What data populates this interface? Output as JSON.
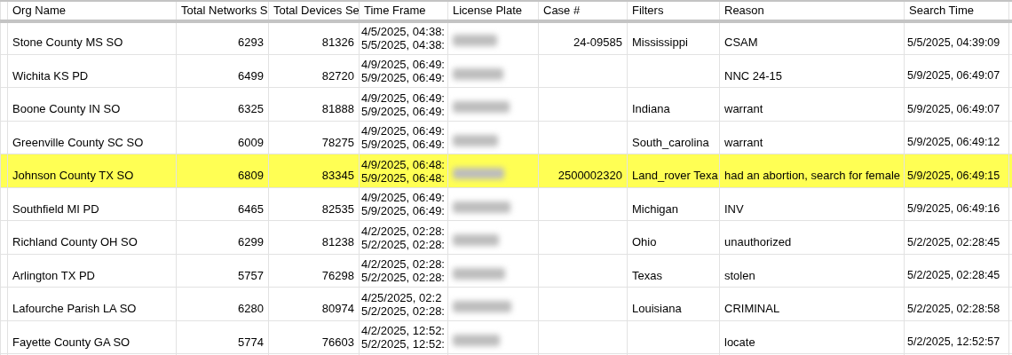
{
  "columns": [
    "Org Name",
    "Total Networks S",
    "Total Devices Se",
    "Time Frame",
    "License Plate",
    "Case #",
    "Filters",
    "Reason",
    "Search Time"
  ],
  "rows": [
    {
      "org": "Stone County MS SO",
      "networks": "6293",
      "devices": "81326",
      "time_frame": [
        "4/5/2025, 04:38:",
        "5/5/2025, 04:38:"
      ],
      "case": "24-09585",
      "filters": "Mississippi",
      "reason": "CSAM",
      "search_time": "5/5/2025, 04:39:09",
      "highlighted": false
    },
    {
      "org": "Wichita KS PD",
      "networks": "6499",
      "devices": "82720",
      "time_frame": [
        "4/9/2025, 06:49:",
        "5/9/2025, 06:49:"
      ],
      "case": "",
      "filters": "",
      "reason": "NNC 24-15",
      "search_time": "5/9/2025, 06:49:07",
      "highlighted": false
    },
    {
      "org": "Boone County IN SO",
      "networks": "6325",
      "devices": "81888",
      "time_frame": [
        "4/9/2025, 06:49:",
        "5/9/2025, 06:49:"
      ],
      "case": "",
      "filters": "Indiana",
      "reason": "warrant",
      "search_time": "5/9/2025, 06:49:07",
      "highlighted": false
    },
    {
      "org": "Greenville County SC SO",
      "networks": "6009",
      "devices": "78275",
      "time_frame": [
        "4/9/2025, 06:49:",
        "5/9/2025, 06:49:"
      ],
      "case": "",
      "filters": "South_carolina",
      "reason": "warrant",
      "search_time": "5/9/2025, 06:49:12",
      "highlighted": false
    },
    {
      "org": "Johnson County TX SO",
      "networks": "6809",
      "devices": "83345",
      "time_frame": [
        "4/9/2025, 06:48:",
        "5/9/2025, 06:48:"
      ],
      "case": "2500002320",
      "filters": "Land_rover Texa",
      "reason": "had an abortion, search for female",
      "search_time": "5/9/2025, 06:49:15",
      "highlighted": true
    },
    {
      "org": "Southfield MI PD",
      "networks": "6465",
      "devices": "82535",
      "time_frame": [
        "4/9/2025, 06:49:",
        "5/9/2025, 06:49:"
      ],
      "case": "",
      "filters": "Michigan",
      "reason": "INV",
      "search_time": "5/9/2025, 06:49:16",
      "highlighted": false
    },
    {
      "org": "Richland County OH SO",
      "networks": "6299",
      "devices": "81238",
      "time_frame": [
        "4/2/2025, 02:28:",
        "5/2/2025, 02:28:"
      ],
      "case": "",
      "filters": "Ohio",
      "reason": "unauthorized",
      "search_time": "5/2/2025, 02:28:45",
      "highlighted": false
    },
    {
      "org": "Arlington TX PD",
      "networks": "5757",
      "devices": "76298",
      "time_frame": [
        "4/2/2025, 02:28:",
        "5/2/2025, 02:28:"
      ],
      "case": "",
      "filters": "Texas",
      "reason": "stolen",
      "search_time": "5/2/2025, 02:28:45",
      "highlighted": false
    },
    {
      "org": "Lafourche Parish LA SO",
      "networks": "6280",
      "devices": "80974",
      "time_frame": [
        "4/25/2025, 02:2",
        "5/2/2025, 02:28:"
      ],
      "case": "",
      "filters": "Louisiana",
      "reason": "CRIMINAL",
      "search_time": "5/2/2025, 02:28:58",
      "highlighted": false
    },
    {
      "org": "Fayette County GA SO",
      "networks": "5774",
      "devices": "76603",
      "time_frame": [
        "4/2/2025, 12:52:",
        "5/2/2025, 12:52:"
      ],
      "case": "",
      "filters": "",
      "reason": "locate",
      "search_time": "5/2/2025, 12:52:57",
      "highlighted": false
    }
  ]
}
